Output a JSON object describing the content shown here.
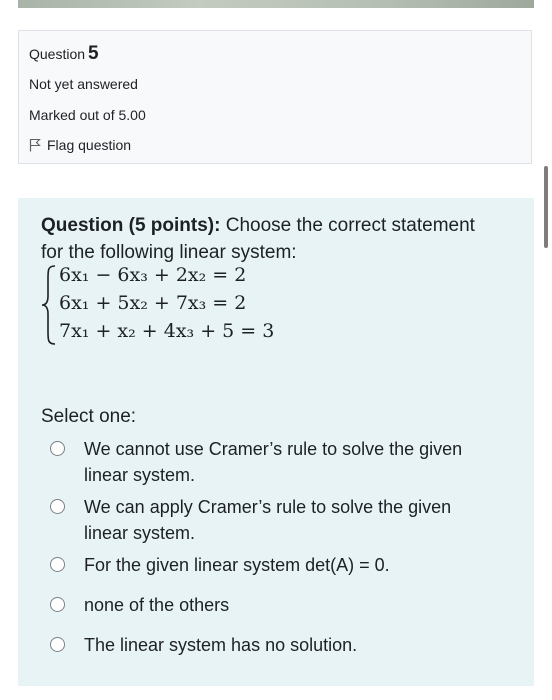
{
  "info": {
    "question_label": "Question",
    "question_number": "5",
    "state": "Not yet answered",
    "grade": "Marked out of 5.00",
    "flag_label": "Flag question"
  },
  "question": {
    "prefix": "Question (5 points):",
    "text": " Choose the correct statement for the following linear system:",
    "equations": [
      "6x₁ − 6x₃ + 2x₂ = 2",
      "6x₁ + 5x₂ + 7x₃ = 2",
      "7x₁ + x₂ + 4x₃ + 5 = 3"
    ]
  },
  "answer": {
    "select_label": "Select one:",
    "options": [
      "We cannot use Cramer’s rule to solve the given linear system.",
      "We can apply Cramer’s rule to solve the given linear system.",
      "For the given linear system det(A) = 0.",
      "none of the others",
      "The linear system has no solution."
    ]
  }
}
